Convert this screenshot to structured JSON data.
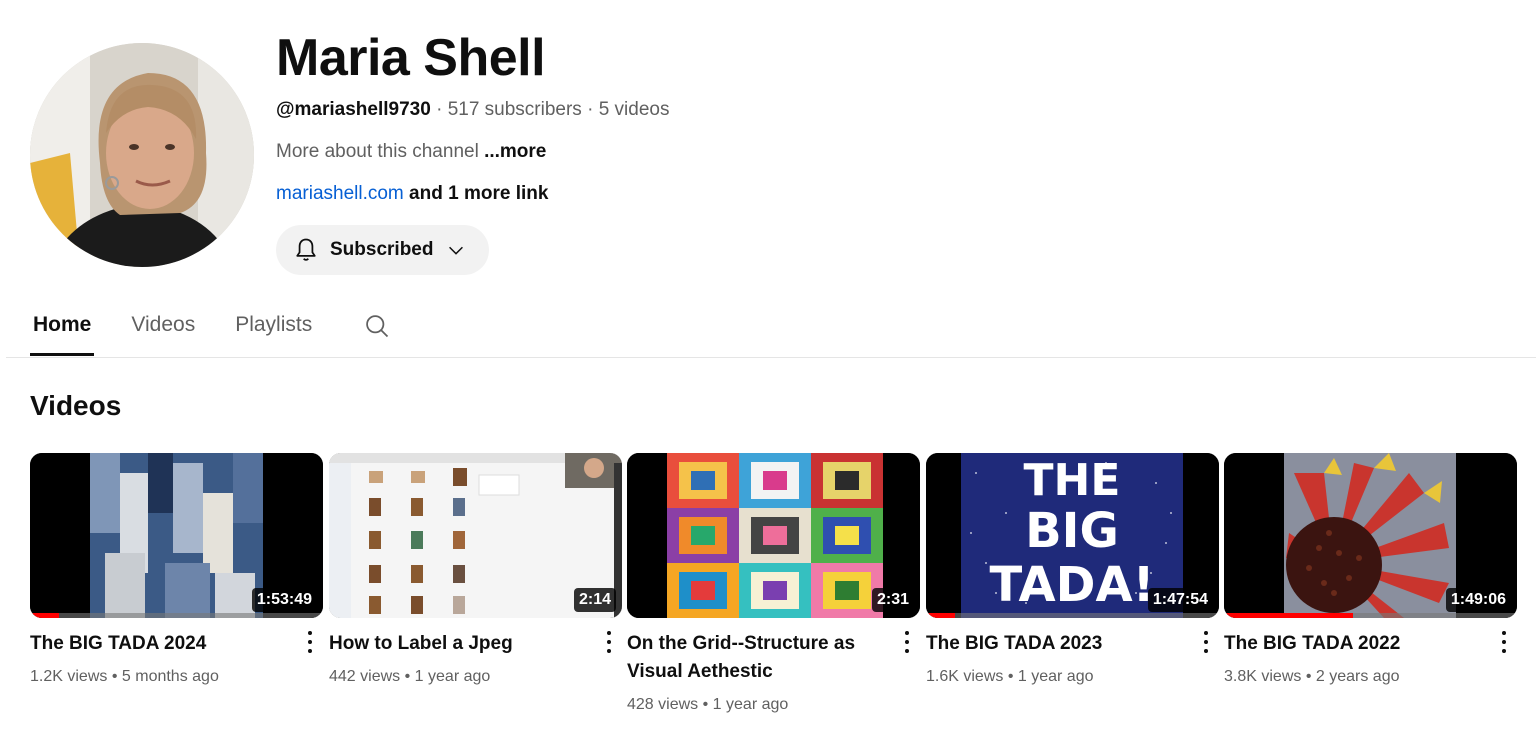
{
  "channel": {
    "name": "Maria Shell",
    "handle": "@mariashell9730",
    "subscribers": "517 subscribers",
    "video_count": "5 videos",
    "separator": "·",
    "description": "More about this channel",
    "more_label": "...more",
    "link": "mariashell.com",
    "more_links": "and 1 more link",
    "subscribe_label": "Subscribed"
  },
  "tabs": [
    {
      "label": "Home",
      "active": true
    },
    {
      "label": "Videos",
      "active": false
    },
    {
      "label": "Playlists",
      "active": false
    }
  ],
  "section": {
    "title": "Videos"
  },
  "meta_separator": "•",
  "videos": [
    {
      "title": "The BIG TADA 2024",
      "views": "1.2K views",
      "age": "5 months ago",
      "duration": "1:53:49",
      "watched_fraction": 0.1
    },
    {
      "title": "How to Label a Jpeg",
      "views": "442 views",
      "age": "1 year ago",
      "duration": "2:14",
      "watched_fraction": 0
    },
    {
      "title": "On the Grid--Structure as Visual Aethestic",
      "views": "428 views",
      "age": "1 year ago",
      "duration": "2:31",
      "watched_fraction": 0
    },
    {
      "title": "The BIG TADA 2023",
      "views": "1.6K views",
      "age": "1 year ago",
      "duration": "1:47:54",
      "watched_fraction": 0.1
    },
    {
      "title": "The BIG TADA 2022",
      "views": "3.8K views",
      "age": "2 years ago",
      "duration": "1:49:06",
      "watched_fraction": 0.44
    }
  ],
  "thumb_text": {
    "big_tada_lines": [
      "THE",
      "BIG",
      "TADA!"
    ]
  },
  "colors": {
    "accent_red": "#ff0000",
    "link_blue": "#065fd4",
    "text_secondary": "#606060"
  },
  "icons": {
    "bell": "bell-icon",
    "chevron": "chevron-down-icon",
    "search": "search-icon",
    "menu": "more-vert-icon"
  }
}
